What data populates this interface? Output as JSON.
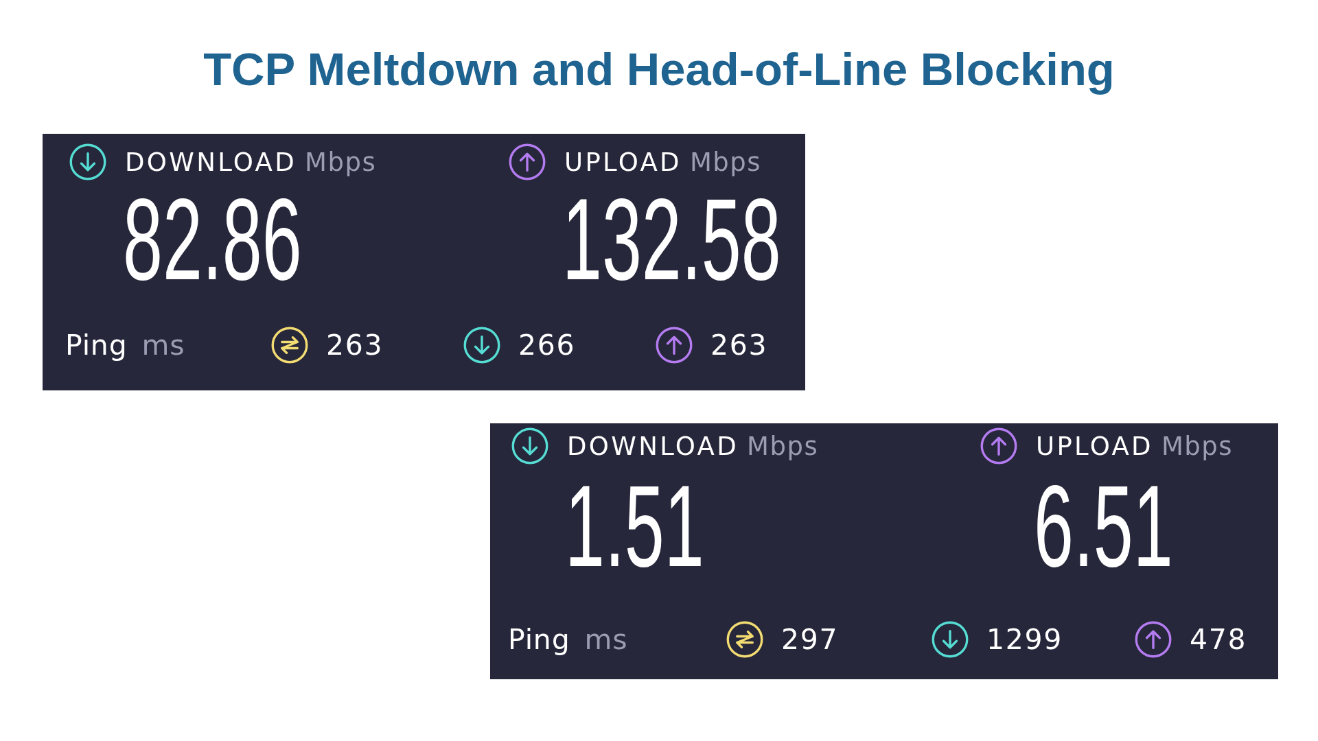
{
  "title": "TCP Meltdown and Head-of-Line Blocking",
  "results": [
    {
      "metrics": [
        {
          "kind": "download",
          "label": "DOWNLOAD",
          "unit": "Mbps",
          "value": "82.86"
        },
        {
          "kind": "upload",
          "label": "UPLOAD",
          "unit": "Mbps",
          "value": "132.58"
        }
      ],
      "ping": {
        "label": "Ping",
        "unit": "ms",
        "readings": [
          {
            "kind": "idle",
            "value": "263"
          },
          {
            "kind": "download",
            "value": "266"
          },
          {
            "kind": "upload",
            "value": "263"
          }
        ]
      }
    },
    {
      "metrics": [
        {
          "kind": "download",
          "label": "DOWNLOAD",
          "unit": "Mbps",
          "value": "1.51"
        },
        {
          "kind": "upload",
          "label": "UPLOAD",
          "unit": "Mbps",
          "value": "6.51"
        }
      ],
      "ping": {
        "label": "Ping",
        "unit": "ms",
        "readings": [
          {
            "kind": "idle",
            "value": "297"
          },
          {
            "kind": "download",
            "value": "1299"
          },
          {
            "kind": "upload",
            "value": "478"
          }
        ]
      }
    }
  ]
}
